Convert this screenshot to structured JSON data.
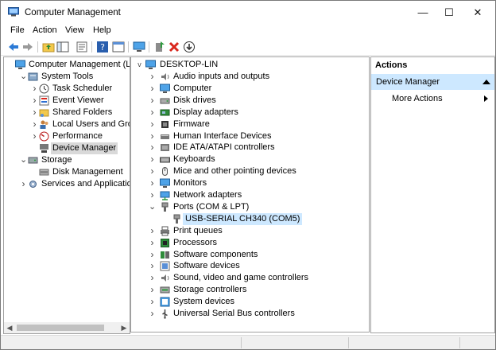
{
  "window": {
    "title": "Computer Management",
    "minimize": "—",
    "maximize": "☐",
    "close": "✕"
  },
  "menu": [
    "File",
    "Action",
    "View",
    "Help"
  ],
  "toolbar": {
    "icons": [
      "back-arrow-icon",
      "forward-arrow-icon",
      "up-folder-icon",
      "show-hide-tree-icon",
      "properties-icon",
      "help-icon",
      "export-list-icon",
      "monitor-icon",
      "scan-hardware-icon",
      "uninstall-icon",
      "update-driver-icon"
    ]
  },
  "left_tree": {
    "items": [
      {
        "label": "Computer Management (Local",
        "icon": "computer-management-icon",
        "chevron": "",
        "level": 0
      },
      {
        "label": "System Tools",
        "icon": "system-tools-icon",
        "chevron": "v",
        "level": 1
      },
      {
        "label": "Task Scheduler",
        "icon": "clock-icon",
        "chevron": ">",
        "level": 2
      },
      {
        "label": "Event Viewer",
        "icon": "event-viewer-icon",
        "chevron": ">",
        "level": 2
      },
      {
        "label": "Shared Folders",
        "icon": "shared-folder-icon",
        "chevron": ">",
        "level": 2
      },
      {
        "label": "Local Users and Groups",
        "icon": "users-icon",
        "chevron": ">",
        "level": 2
      },
      {
        "label": "Performance",
        "icon": "performance-icon",
        "chevron": ">",
        "level": 2
      },
      {
        "label": "Device Manager",
        "icon": "device-manager-icon",
        "chevron": "",
        "level": 2,
        "selected": true
      },
      {
        "label": "Storage",
        "icon": "storage-icon",
        "chevron": "v",
        "level": 1
      },
      {
        "label": "Disk Management",
        "icon": "disk-management-icon",
        "chevron": "",
        "level": 2
      },
      {
        "label": "Services and Applications",
        "icon": "services-icon",
        "chevron": ">",
        "level": 1
      }
    ]
  },
  "device_tree": {
    "root": "DESKTOP-LIN",
    "items": [
      {
        "label": "Audio inputs and outputs",
        "icon": "speaker-icon",
        "chevron": ">"
      },
      {
        "label": "Computer",
        "icon": "computer-icon",
        "chevron": ">"
      },
      {
        "label": "Disk drives",
        "icon": "disk-drive-icon",
        "chevron": ">"
      },
      {
        "label": "Display adapters",
        "icon": "display-adapter-icon",
        "chevron": ">"
      },
      {
        "label": "Firmware",
        "icon": "firmware-icon",
        "chevron": ">"
      },
      {
        "label": "Human Interface Devices",
        "icon": "hid-icon",
        "chevron": ">"
      },
      {
        "label": "IDE ATA/ATAPI controllers",
        "icon": "ide-icon",
        "chevron": ">"
      },
      {
        "label": "Keyboards",
        "icon": "keyboard-icon",
        "chevron": ">"
      },
      {
        "label": "Mice and other pointing devices",
        "icon": "mouse-icon",
        "chevron": ">"
      },
      {
        "label": "Monitors",
        "icon": "monitor-icon",
        "chevron": ">"
      },
      {
        "label": "Network adapters",
        "icon": "network-adapter-icon",
        "chevron": ">"
      },
      {
        "label": "Ports (COM & LPT)",
        "icon": "port-icon",
        "chevron": "v"
      },
      {
        "label": "USB-SERIAL CH340 (COM5)",
        "icon": "serial-port-icon",
        "chevron": "",
        "child": true,
        "highlighted": true
      },
      {
        "label": "Print queues",
        "icon": "printer-icon",
        "chevron": ">"
      },
      {
        "label": "Processors",
        "icon": "processor-icon",
        "chevron": ">"
      },
      {
        "label": "Software components",
        "icon": "software-component-icon",
        "chevron": ">"
      },
      {
        "label": "Software devices",
        "icon": "software-device-icon",
        "chevron": ">"
      },
      {
        "label": "Sound, video and game controllers",
        "icon": "sound-icon",
        "chevron": ">"
      },
      {
        "label": "Storage controllers",
        "icon": "storage-controller-icon",
        "chevron": ">"
      },
      {
        "label": "System devices",
        "icon": "system-device-icon",
        "chevron": ">"
      },
      {
        "label": "Universal Serial Bus controllers",
        "icon": "usb-icon",
        "chevron": ">"
      }
    ]
  },
  "actions": {
    "header": "Actions",
    "section": "Device Manager",
    "items": [
      "More Actions"
    ]
  },
  "colors": {
    "selection": "#cde8ff",
    "tree_selected": "#d9d9d9"
  }
}
